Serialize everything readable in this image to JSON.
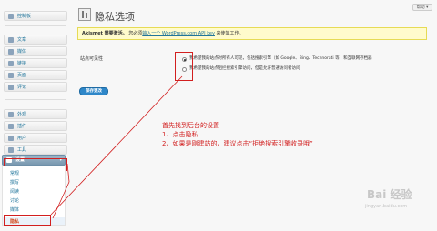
{
  "sidebar": {
    "dashboard": "控制板",
    "posts": "文章",
    "media": "媒体",
    "links": "链接",
    "pages": "页面",
    "comments": "评论",
    "appearance": "外观",
    "plugins": "插件",
    "users": "用户",
    "tools": "工具",
    "settings": "设置",
    "settings_sub": [
      "常规",
      "撰写",
      "阅读",
      "讨论",
      "媒体"
    ],
    "settings_active": "隐私"
  },
  "header": {
    "title": "隐私选项",
    "help": "帮助 ▾"
  },
  "notice": {
    "bold": "Akismet 需要激活。",
    "pre": "您必须",
    "link": "输入一个 WordPress.com API key",
    "post": " 来使其工作。"
  },
  "form": {
    "field_label": "站点可见性",
    "option1": "我希望我的站点对所有人可见，包括搜索引擎（如 Google、Bing、Technorati 等）和互联网存档器",
    "option2": "我希望我的站点阻拦搜索引擎访问，但是允许普通访问者访问",
    "option1_selected": true,
    "save": "保存更改"
  },
  "annotation": {
    "line1": "首先找到后台的设置",
    "line2": "1、点击隐私",
    "line3": "2、如果是刚建站的，建议点击“拒绝搜索引擎收录哦”"
  },
  "watermark": {
    "brand": "Bai 经验",
    "sub": "jingyan.baidu.com"
  },
  "colors": {
    "annotation_red": "#d21f1f",
    "notice_bg": "#fffbcc",
    "link_blue": "#21759b",
    "button_blue": "#2e87c9"
  }
}
